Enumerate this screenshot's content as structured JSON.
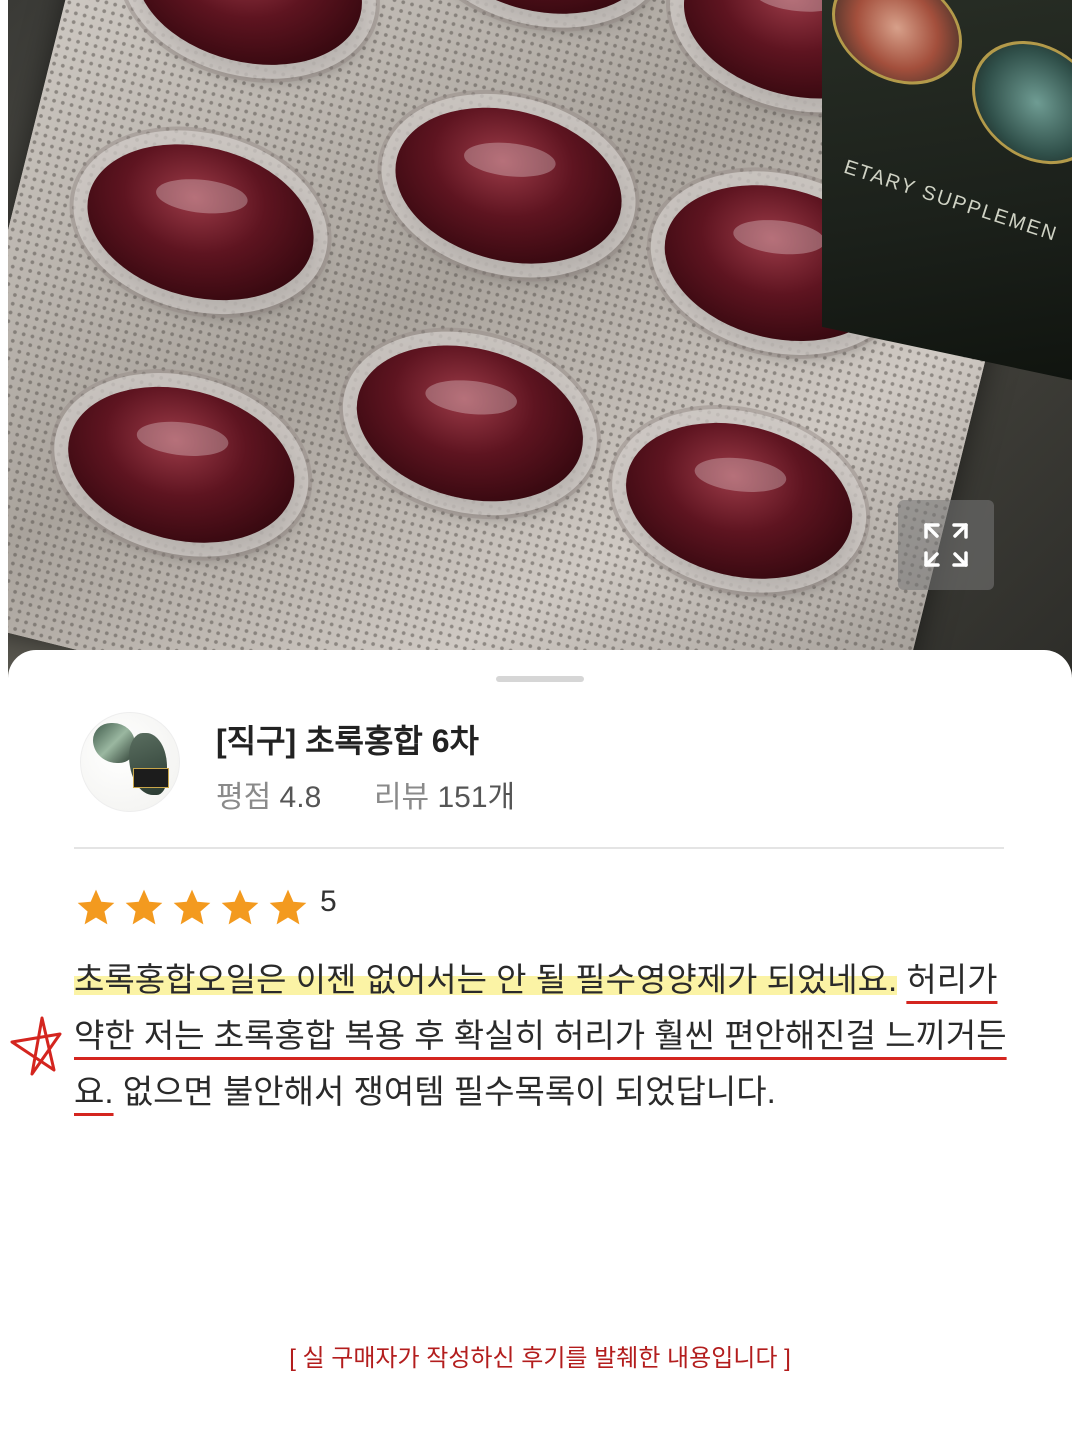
{
  "photo": {
    "box_text": "ETARY SUPPLEMEN",
    "expand_icon": "expand-icon"
  },
  "product": {
    "title": "[직구] 초록홍합 6차",
    "rating_label": "평점",
    "rating_value": "4.8",
    "review_label": "리뷰",
    "review_count": "151개"
  },
  "review": {
    "stars": 5,
    "star_color": "#f39a1f",
    "score": "5",
    "text_highlighted": "초록홍합오일은 이젠 없어서는 안 될 필수영양제가 되었네요.",
    "text_underlined": "허리가 약한 저는 초록홍합 복용 후 확실히 허리가 훨씬 편안해진걸 느끼거든요.",
    "text_rest": "없으면 불안해서 쟁여템 필수목록이 되었답니다."
  },
  "footer": {
    "note": "[ 실 구매자가 작성하신 후기를 발췌한 내용입니다 ]"
  },
  "colors": {
    "highlight": "#fbf3a5",
    "underline": "#d4251f",
    "footer_text": "#b31d1d"
  }
}
